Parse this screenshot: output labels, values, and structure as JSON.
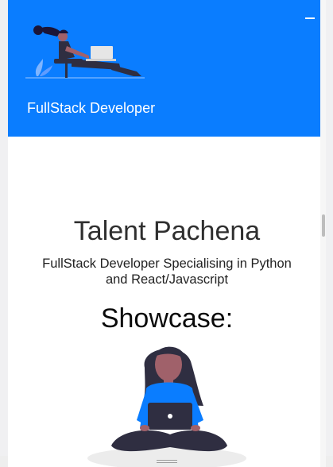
{
  "header": {
    "brand": "FullStack Developer",
    "menu_icon": "hamburger-menu-icon",
    "background_color": "#0a7dff"
  },
  "profile": {
    "name": "Talent Pachena",
    "tagline": "FullStack Developer Specialising in Python and React/Javascript"
  },
  "showcase": {
    "title": "Showcase:"
  },
  "illustrations": {
    "hero": "developer-at-laptop-illustration",
    "showcase": "person-with-laptop-illustration"
  },
  "colors": {
    "accent": "#0a7dff",
    "text_dark": "#2f2f2f"
  }
}
